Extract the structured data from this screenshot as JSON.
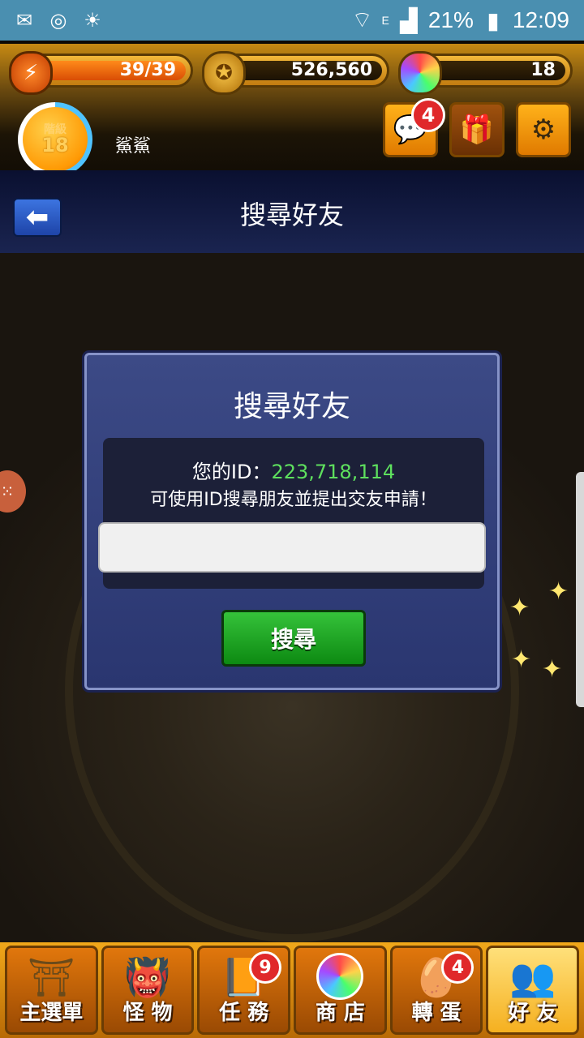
{
  "status_bar": {
    "battery": "21%",
    "time": "12:09",
    "network": "E"
  },
  "top_bar": {
    "stamina": "39/39",
    "coins": "526,560",
    "orbs": "18",
    "level_label": "階級",
    "level": "18",
    "player_name": "鯊鯊",
    "chat_badge": "4"
  },
  "header": {
    "title": "搜尋好友"
  },
  "dialog": {
    "title": "搜尋好友",
    "id_label": "您的ID：",
    "id_value": "223,718,114",
    "hint": "可使用ID搜尋朋友並提出交友申請！",
    "input_value": "",
    "input_placeholder": "",
    "search_button": "搜尋"
  },
  "bottom_nav": {
    "items": [
      {
        "label": "主選單",
        "icon": "home-gate-icon"
      },
      {
        "label": "怪 物",
        "icon": "monster-icon"
      },
      {
        "label": "任 務",
        "icon": "quest-book-icon",
        "badge": "9"
      },
      {
        "label": "商 店",
        "icon": "orb-shop-icon"
      },
      {
        "label": "轉 蛋",
        "icon": "egg-gacha-icon",
        "badge": "4"
      },
      {
        "label": "好 友",
        "icon": "friends-icon"
      }
    ]
  }
}
